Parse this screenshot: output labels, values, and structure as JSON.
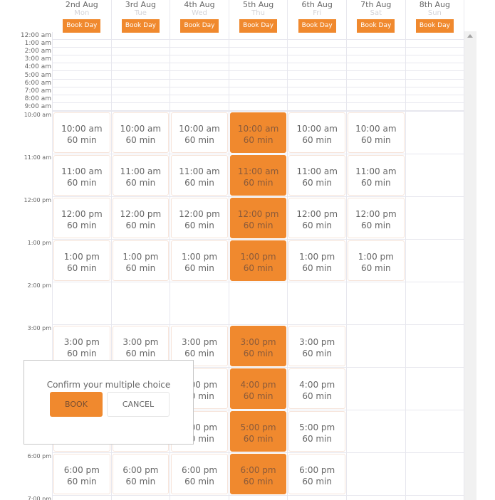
{
  "days": [
    {
      "date": "2nd Aug",
      "weekday": "Mon",
      "book_label": "Book Day"
    },
    {
      "date": "3rd Aug",
      "weekday": "Tue",
      "book_label": "Book Day"
    },
    {
      "date": "4th Aug",
      "weekday": "Wed",
      "book_label": "Book Day"
    },
    {
      "date": "5th Aug",
      "weekday": "Thu",
      "book_label": "Book Day"
    },
    {
      "date": "6th Aug",
      "weekday": "Fri",
      "book_label": "Book Day"
    },
    {
      "date": "7th Aug",
      "weekday": "Sat",
      "book_label": "Book Day"
    },
    {
      "date": "8th Aug",
      "weekday": "Sun",
      "book_label": "Book Day"
    }
  ],
  "time_labels": [
    "12:00 am",
    "1:00 am",
    "2:00 am",
    "3:00 am",
    "4:00 am",
    "5:00 am",
    "6:00 am",
    "7:00 am",
    "8:00 am",
    "9:00 am",
    "10:00 am",
    "11:00 am",
    "12:00 pm",
    "1:00 pm",
    "2:00 pm",
    "3:00 pm",
    "4:00 pm",
    "5:00 pm",
    "6:00 pm",
    "7:00 pm"
  ],
  "slot_duration": "60 min",
  "slot_rows": [
    {
      "time": "10:00 am",
      "days": [
        0,
        1,
        2,
        3,
        4,
        5
      ]
    },
    {
      "time": "11:00 am",
      "days": [
        0,
        1,
        2,
        3,
        4,
        5
      ]
    },
    {
      "time": "12:00 pm",
      "days": [
        0,
        1,
        2,
        3,
        4,
        5
      ]
    },
    {
      "time": "1:00 pm",
      "days": [
        0,
        1,
        2,
        3,
        4,
        5
      ]
    },
    {
      "time": "2:00 pm",
      "days": []
    },
    {
      "time": "3:00 pm",
      "days": [
        0,
        1,
        2,
        3,
        4
      ]
    },
    {
      "time": "4:00 pm",
      "days": [
        0,
        1,
        2,
        3,
        4
      ]
    },
    {
      "time": "5:00 pm",
      "days": [
        0,
        1,
        2,
        3,
        4
      ]
    },
    {
      "time": "6:00 pm",
      "days": [
        0,
        1,
        2,
        3,
        4
      ]
    }
  ],
  "selected_day": 3,
  "dialog": {
    "message": "Confirm your multiple choice",
    "book_label": "BOOK",
    "cancel_label": "CANCEL"
  },
  "colors": {
    "accent": "#f0892e"
  }
}
